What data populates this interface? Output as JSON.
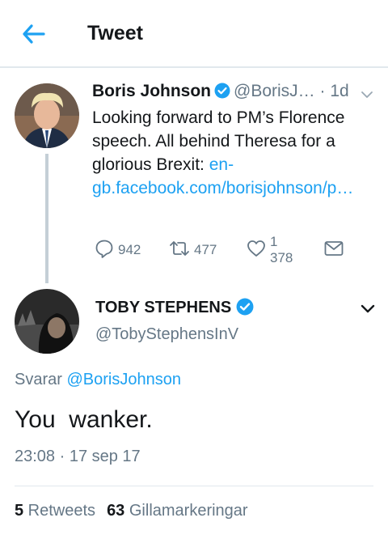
{
  "header": {
    "title": "Tweet",
    "back_icon": "back-arrow-icon",
    "accent": "#1da1f2"
  },
  "parent_tweet": {
    "author_name": "Boris Johnson",
    "handle": "@BorisJ…",
    "separator": " · ",
    "time": "1d",
    "verified_icon": "verified-badge-icon",
    "text_plain": "Looking forward to PM’s Florence speech. All behind Theresa for a glorious Brexit: ",
    "text_link": "en-gb.facebook.com/borisjohnson/p…",
    "replies": "942",
    "retweets": "477",
    "likes": "1 378"
  },
  "reply_tweet": {
    "author_name": "TOBY STEPHENS",
    "handle": "@TobyStephensInV",
    "replying_prefix": "Svarar ",
    "replying_to": "@BorisJohnson",
    "text": "You  wanker.",
    "timestamp": "23:08 · 17 sep 17",
    "retweet_count": "5",
    "retweet_label": " Retweets",
    "like_count": "63",
    "like_label": " Gillamarkeringar"
  },
  "colors": {
    "link": "#1da1f2",
    "muted": "#657786",
    "text": "#14171a",
    "divider": "#e1e8ed"
  }
}
